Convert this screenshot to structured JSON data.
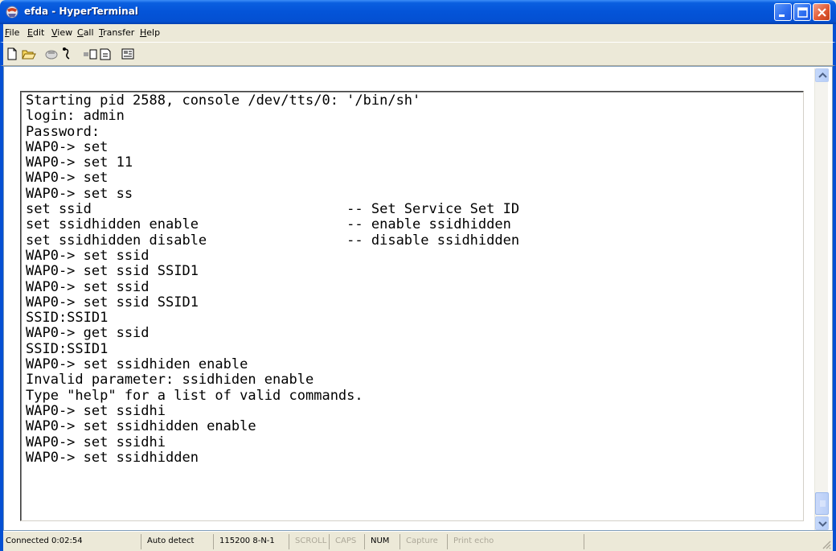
{
  "window": {
    "title": "efda - HyperTerminal",
    "icon": "hyperterminal-icon",
    "controls": [
      "minimize-icon",
      "maximize-icon",
      "close-icon"
    ]
  },
  "menu": [
    {
      "label": "File",
      "accel": "F",
      "rest": "ile"
    },
    {
      "label": "Edit",
      "accel": "E",
      "rest": "dit"
    },
    {
      "label": "View",
      "accel": "V",
      "rest": "iew"
    },
    {
      "label": "Call",
      "accel": "C",
      "rest": "all"
    },
    {
      "label": "Transfer",
      "accel": "T",
      "rest": "ransfer"
    },
    {
      "label": "Help",
      "accel": "H",
      "rest": "elp"
    }
  ],
  "toolbar": {
    "buttons": [
      "new-icon",
      "open-icon",
      "connect-icon",
      "disconnect-icon",
      "send-icon",
      "receive-icon",
      "properties-icon"
    ]
  },
  "terminal": {
    "lines": [
      "Starting pid 2588, console /dev/tts/0: '/bin/sh'",
      "login: admin",
      "Password:",
      "WAP0-> set",
      "WAP0-> set 11",
      "WAP0-> set",
      "WAP0-> set ss",
      "set ssid                               -- Set Service Set ID",
      "set ssidhidden enable                  -- enable ssidhidden",
      "set ssidhidden disable                 -- disable ssidhidden",
      "WAP0-> set ssid",
      "WAP0-> set ssid SSID1",
      "WAP0-> set ssid",
      "WAP0-> set ssid SSID1",
      "SSID:SSID1",
      "WAP0-> get ssid",
      "SSID:SSID1",
      "WAP0-> set ssidhiden enable",
      "Invalid parameter: ssidhiden enable",
      "Type \"help\" for a list of valid commands.",
      "WAP0-> set ssidhi",
      "WAP0-> set ssidhidden enable",
      "WAP0-> set ssidhi",
      "WAP0-> set ssidhidden"
    ]
  },
  "statusbar": {
    "connected": "Connected 0:02:54",
    "detect": "Auto detect",
    "port": "115200 8-N-1",
    "scroll": "SCROLL",
    "caps": "CAPS",
    "num": "NUM",
    "capture": "Capture",
    "print_echo": "Print echo"
  },
  "colors": {
    "titlebar": "#0454d8",
    "chrome": "#ece9d8",
    "terminal_bg": "#ffffff",
    "terminal_fg": "#000000"
  }
}
